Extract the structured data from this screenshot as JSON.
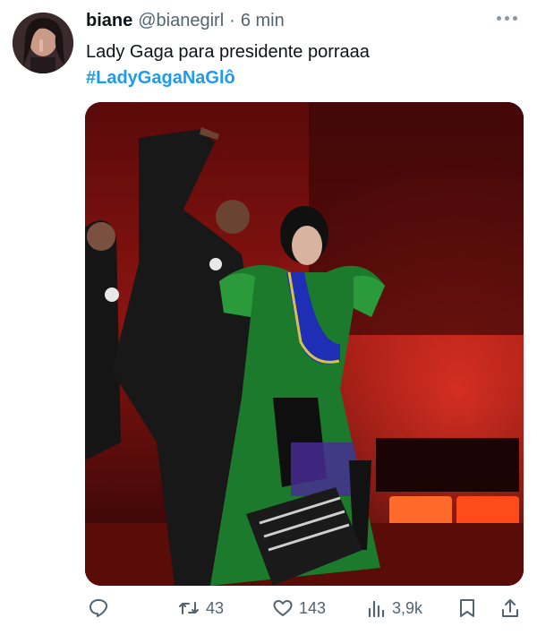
{
  "tweet": {
    "name": "biane",
    "handle": "@bianegirl",
    "separator": "·",
    "time": "6 min",
    "text": "Lady Gaga para presidente porraaa",
    "hashtag": "#LadyGagaNaGlô"
  },
  "actions": {
    "reposts": "43",
    "likes": "143",
    "views": "3,9k"
  },
  "colors": {
    "accent": "#1d9bf0",
    "muted": "#536471",
    "text": "#0f1419"
  },
  "icons": [
    "reply-icon",
    "repost-icon",
    "like-icon",
    "views-icon",
    "bookmark-icon",
    "share-icon",
    "more-icon"
  ]
}
